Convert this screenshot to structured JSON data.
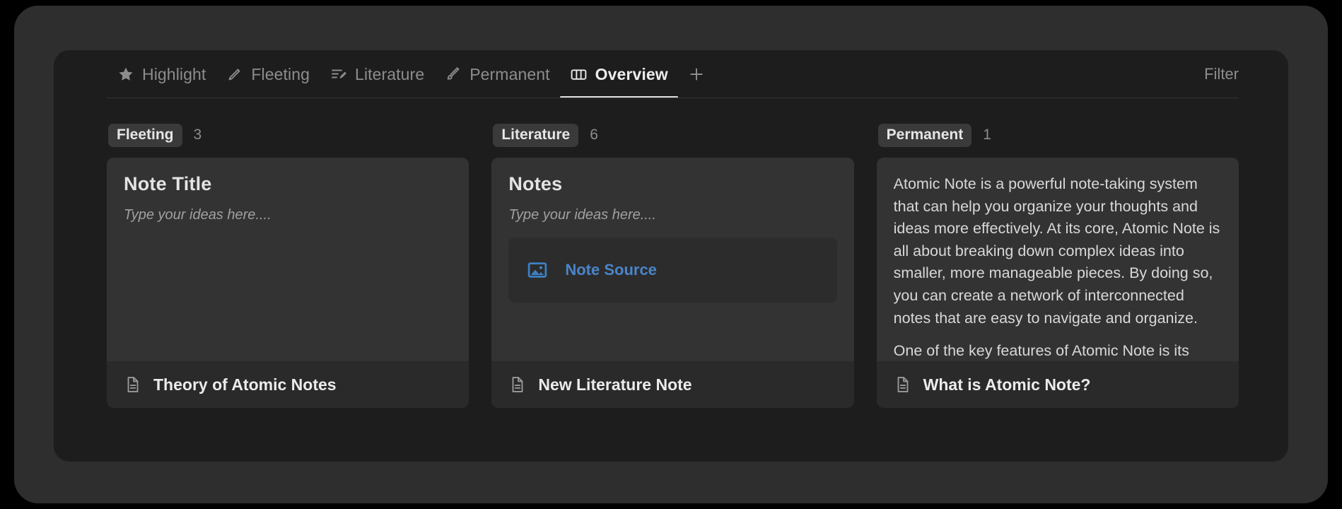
{
  "window": {
    "accent_blue": "#4a85c9",
    "panel_bg": "#1d1d1d",
    "card_bg": "#333333"
  },
  "tabs": [
    {
      "label": "Highlight",
      "icon": "star-icon",
      "active": false
    },
    {
      "label": "Fleeting",
      "icon": "pencil-icon",
      "active": false
    },
    {
      "label": "Literature",
      "icon": "list-pencil-icon",
      "active": false
    },
    {
      "label": "Permanent",
      "icon": "brush-icon",
      "active": false
    },
    {
      "label": "Overview",
      "icon": "columns-icon",
      "active": true
    }
  ],
  "tab_add_label": "+",
  "filter_label": "Filter",
  "columns": [
    {
      "chip": "Fleeting",
      "count": "3",
      "card": {
        "title": "Note Title",
        "placeholder": "Type your ideas here....",
        "footer_label": "Theory of Atomic Notes",
        "footer_icon": "document-icon"
      }
    },
    {
      "chip": "Literature",
      "count": "6",
      "card": {
        "title": "Notes",
        "placeholder": "Type your ideas here....",
        "source_label": "Note Source",
        "source_icon": "image-icon",
        "footer_label": "New Literature Note",
        "footer_icon": "document-icon"
      }
    },
    {
      "chip": "Permanent",
      "count": "1",
      "card": {
        "paragraph_1": "Atomic Note is a powerful note-taking system that can help you organize your thoughts and ideas more effectively. At its core, Atomic Note is all about breaking down complex ideas into smaller, more manageable pieces. By doing so, you can create a network of interconnected notes that are easy to navigate and organize.",
        "paragraph_2": "One of the key features of Atomic Note is its emphasis on focused notes. Each note should",
        "footer_label": "What is Atomic Note?",
        "footer_icon": "document-icon"
      }
    }
  ]
}
